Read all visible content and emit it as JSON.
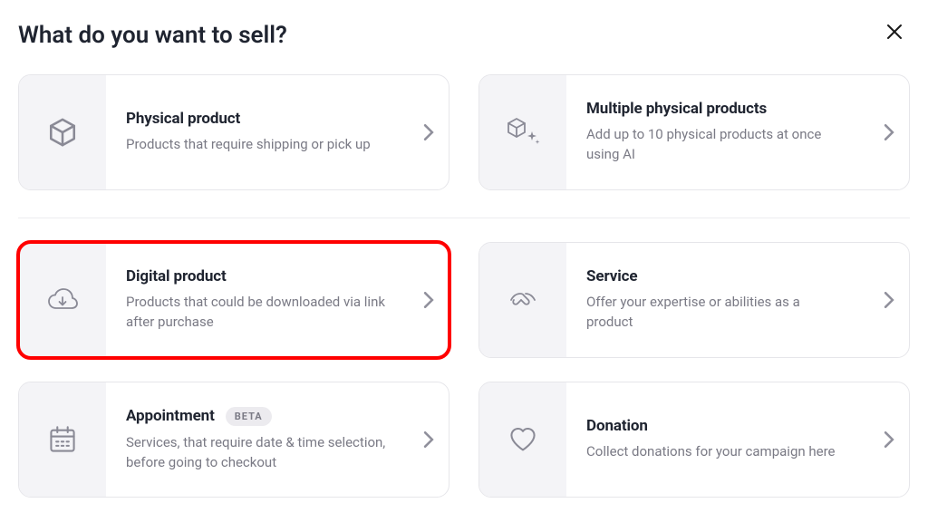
{
  "page": {
    "title": "What do you want to sell?"
  },
  "options": {
    "physical": {
      "title": "Physical product",
      "desc": "Products that require shipping or pick up"
    },
    "multiple": {
      "title": "Multiple physical products",
      "desc": "Add up to 10 physical products at once using AI"
    },
    "digital": {
      "title": "Digital product",
      "desc": "Products that could be downloaded via link after purchase"
    },
    "service": {
      "title": "Service",
      "desc": "Offer your expertise or abilities as a product"
    },
    "appointment": {
      "title": "Appointment",
      "badge": "BETA",
      "desc": "Services, that require date & time selection, before going to checkout"
    },
    "donation": {
      "title": "Donation",
      "desc": "Collect donations for your campaign here"
    }
  }
}
